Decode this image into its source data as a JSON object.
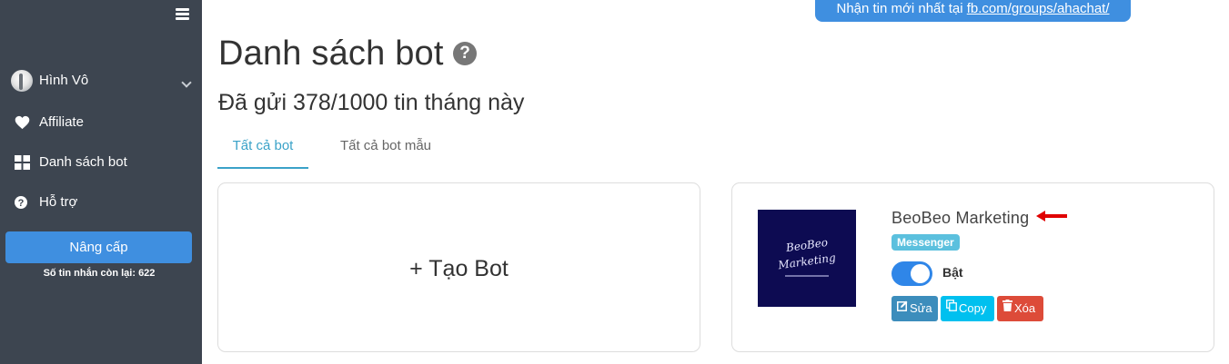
{
  "sidebar": {
    "user_name": "Hình Vô",
    "items": [
      {
        "label": "Affiliate",
        "icon": "heart-icon"
      },
      {
        "label": "Danh sách bot",
        "icon": "grid-icon"
      },
      {
        "label": "Hỗ trợ",
        "icon": "question-circle-icon"
      }
    ],
    "upgrade_label": "Nâng cấp",
    "messages_left": "Số tin nhắn còn lại: 622"
  },
  "notice": {
    "text": "Nhận tin mới nhất tại ",
    "link": "fb.com/groups/ahachat/"
  },
  "header": {
    "title": "Danh sách bot",
    "sent_info": "Đã gửi 378/1000 tin tháng này"
  },
  "tabs": [
    {
      "label": "Tất cả bot",
      "active": true
    },
    {
      "label": "Tất cả bot mẫu",
      "active": false
    }
  ],
  "create_card": {
    "label": "+ Tạo Bot"
  },
  "bot": {
    "name": "BeoBeo Marketing",
    "platform": "Messenger",
    "status_label": "Bật",
    "enabled": true,
    "thumb_lines": [
      "BeoBeo",
      "Marketing"
    ],
    "edit_label": "Sửa",
    "copy_label": "Copy",
    "delete_label": "Xóa"
  },
  "colors": {
    "sidebar_bg": "#3d4550",
    "accent_blue": "#3f8fe0",
    "tab_active": "#3aa2c8",
    "badge": "#5bc0de",
    "edit": "#3c8dbc",
    "copy": "#00c0ef",
    "delete": "#dd4b39",
    "arrow": "#e00000"
  }
}
